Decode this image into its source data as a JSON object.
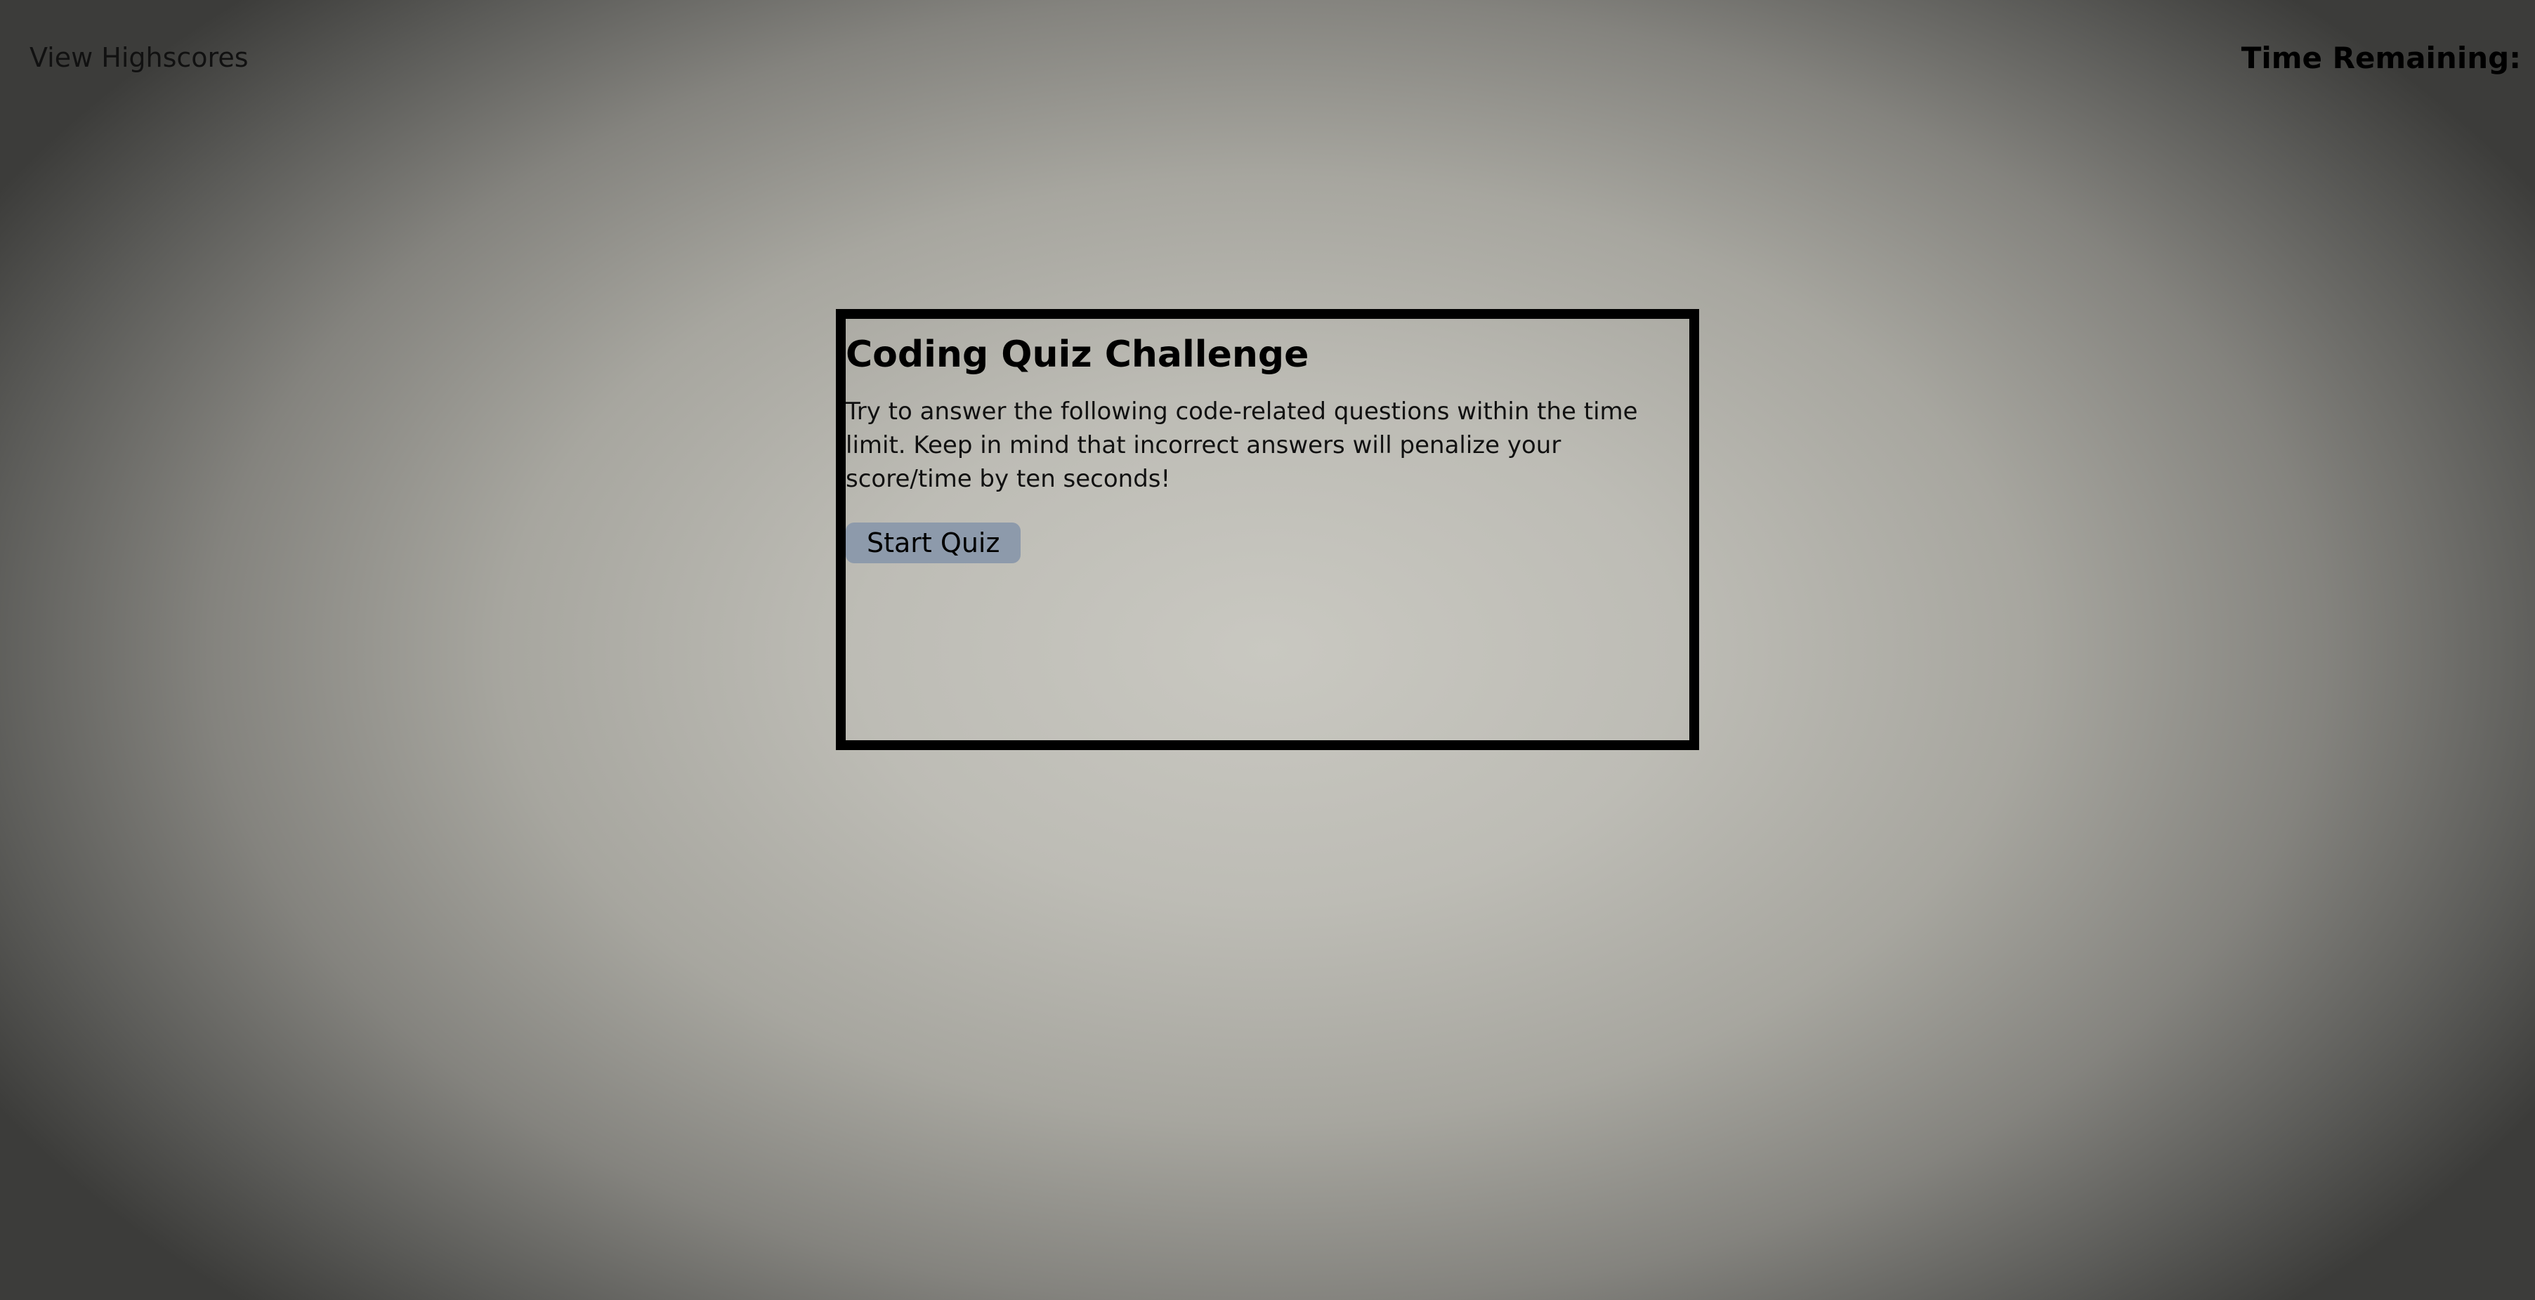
{
  "header": {
    "highscores_label": "View Highscores",
    "timer_label": "Time Remaining:"
  },
  "quiz": {
    "title": "Coding Quiz Challenge",
    "description": "Try to answer the following code-related questions within the time limit. Keep in mind that incorrect answers will penalize your score/time by ten seconds!",
    "start_label": "Start Quiz"
  },
  "colors": {
    "button_background": "#8d9aab",
    "card_border": "#000000",
    "page_center": "#c9c8c1",
    "page_edge": "#3c3c3a"
  }
}
